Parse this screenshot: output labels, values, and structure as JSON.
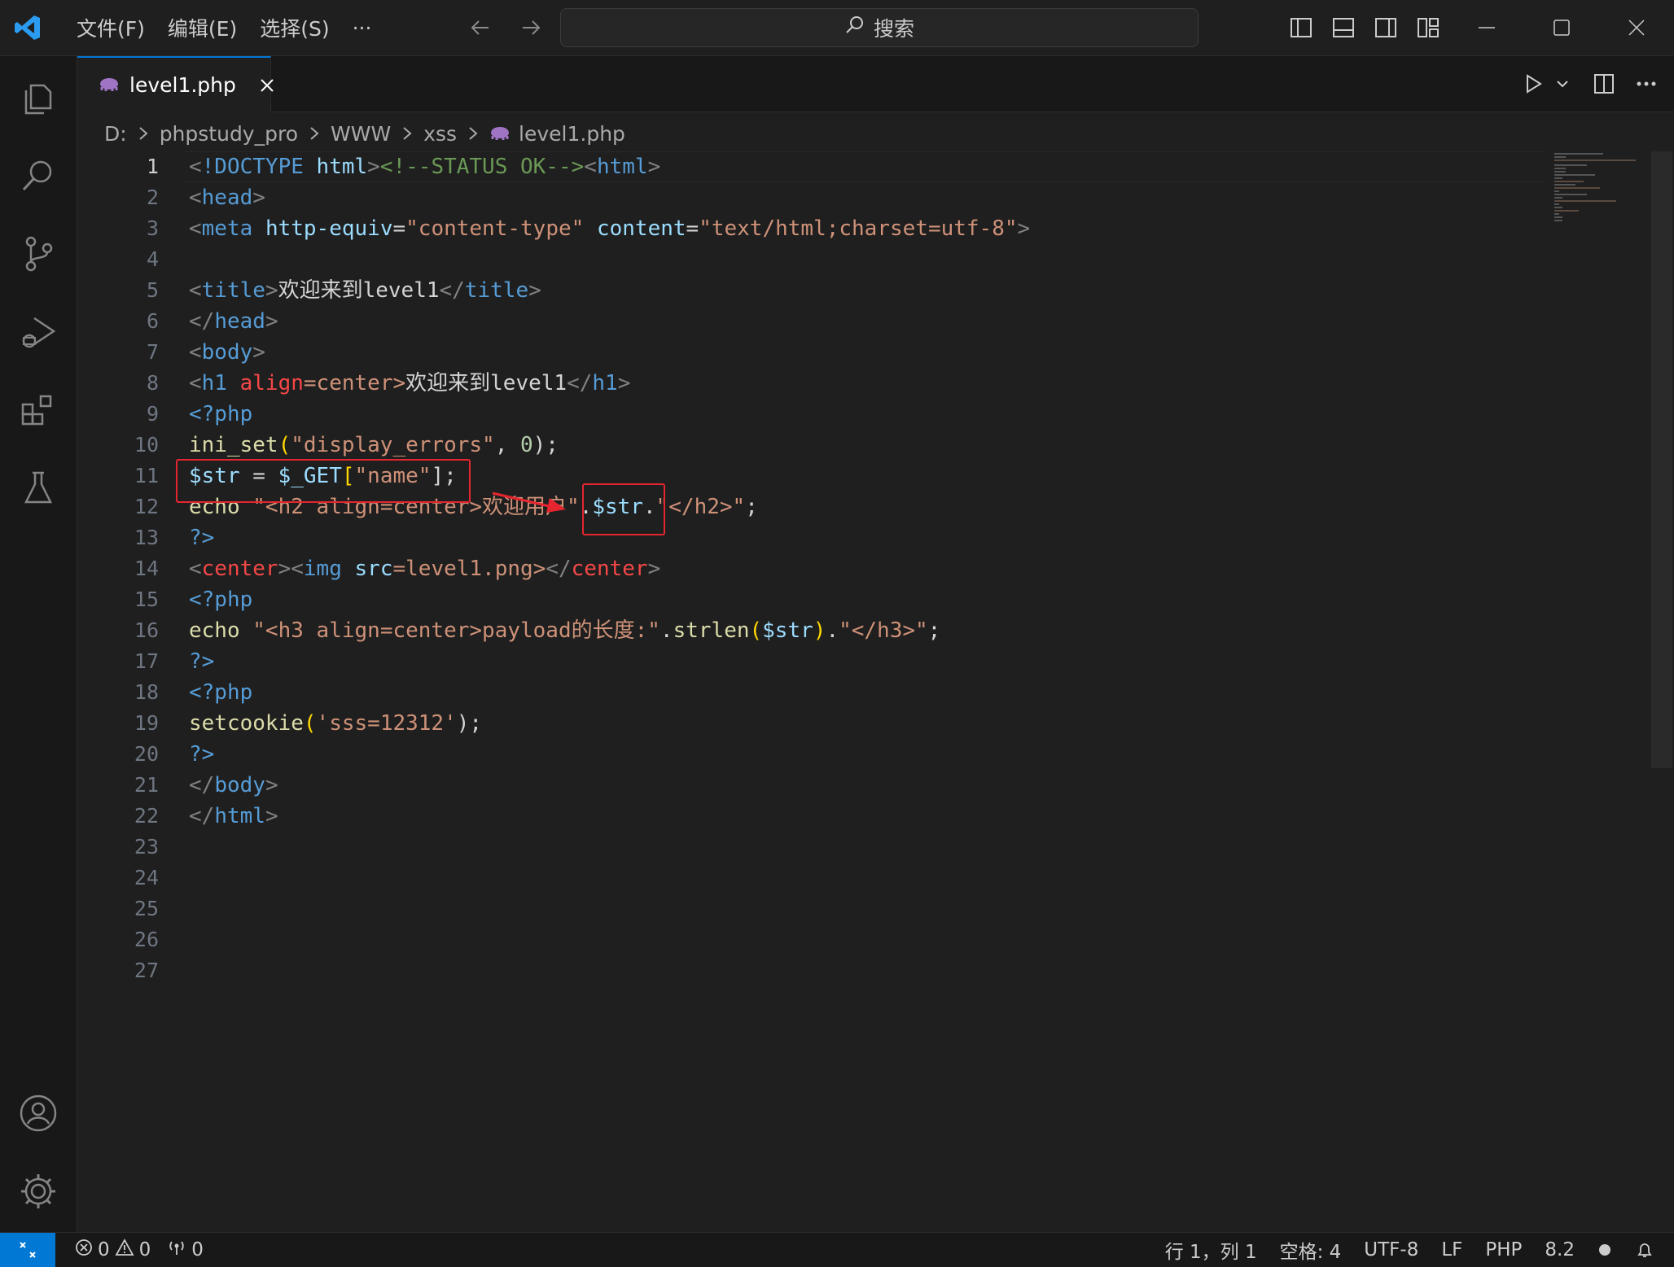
{
  "menu": {
    "file": "文件(F)",
    "edit": "编辑(E)",
    "selection": "选择(S)",
    "more": "···"
  },
  "search": {
    "label": "搜索"
  },
  "tab": {
    "filename": "level1.php"
  },
  "breadcrumb": {
    "drive": "D:",
    "folder1": "phpstudy_pro",
    "folder2": "WWW",
    "folder3": "xss",
    "file": "level1.php"
  },
  "gutter": [
    "1",
    "2",
    "3",
    "4",
    "5",
    "6",
    "7",
    "8",
    "9",
    "10",
    "11",
    "12",
    "13",
    "14",
    "15",
    "16",
    "17",
    "18",
    "19",
    "20",
    "21",
    "22",
    "23",
    "24",
    "25",
    "26",
    "27"
  ],
  "code": {
    "l1": {
      "a": "<",
      "b": "!DOCTYPE",
      "c": " ",
      "d": "html",
      "e": ">",
      "f": "<!--STATUS OK-->",
      "g": "<",
      "h": "html",
      "i": ">"
    },
    "l2": {
      "a": "<",
      "b": "head",
      "c": ">"
    },
    "l3": {
      "a": "<",
      "b": "meta",
      "c": " ",
      "d": "http-equiv",
      "e": "=",
      "f": "\"content-type\"",
      "g": " ",
      "h": "content",
      "i": "=",
      "j": "\"text/html;charset=utf-8\"",
      "k": ">"
    },
    "l5": {
      "a": "<",
      "b": "title",
      "c": ">",
      "d": "欢迎来到level1",
      "e": "</",
      "f": "title",
      "g": ">"
    },
    "l6": {
      "a": "</",
      "b": "head",
      "c": ">"
    },
    "l7": {
      "a": "<",
      "b": "body",
      "c": ">"
    },
    "l8": {
      "a": "<",
      "b": "h1",
      "c": " ",
      "d": "align",
      "e": "=center>",
      "f": "欢迎来到level1",
      "g": "</",
      "h": "h1",
      "i": ">"
    },
    "l9": {
      "a": "<?php"
    },
    "l10": {
      "a": "ini_set",
      "b": "(",
      "c": "\"display_errors\"",
      "d": ", ",
      "e": "0",
      "f": ");"
    },
    "l11": {
      "a": "$str",
      "b": " = ",
      "c": "$_GET",
      "d": "[",
      "e": "\"name\"",
      "f": "];"
    },
    "l12": {
      "a": "echo",
      "b": " ",
      "c": "\"<h2 align=center>欢迎用户\"",
      "d": ".",
      "e": "$str",
      "f": ".",
      "g": "\"</h2>\"",
      "h": ";"
    },
    "l13": {
      "a": "?>"
    },
    "l14": {
      "a": "<",
      "b": "center",
      "c": ">",
      "d": "<",
      "e": "img",
      "f": " ",
      "g": "src",
      "h": "=level1.png>",
      "i": "</",
      "j": "center",
      "k": ">"
    },
    "l15": {
      "a": "<?php"
    },
    "l16": {
      "a": "echo",
      "b": " ",
      "c": "\"<h3 align=center>payload的长度:\"",
      "d": ".",
      "e": "strlen",
      "f": "(",
      "g": "$str",
      "h": ")",
      "i": ".",
      "j": "\"</h3>\"",
      "k": ";"
    },
    "l17": {
      "a": "?>"
    },
    "l18": {
      "a": "<?php"
    },
    "l19": {
      "a": "setcookie",
      "b": "(",
      "c": "'sss=12312'",
      "d": ");"
    },
    "l20": {
      "a": "?>"
    },
    "l21": {
      "a": "</",
      "b": "body",
      "c": ">"
    },
    "l22": {
      "a": "</",
      "b": "html",
      "c": ">"
    }
  },
  "status": {
    "errors": "0",
    "warnings": "0",
    "ports": "0",
    "position": "行 1，列 1",
    "spaces": "空格: 4",
    "encoding": "UTF-8",
    "eol": "LF",
    "language": "PHP",
    "version": "8.2"
  }
}
